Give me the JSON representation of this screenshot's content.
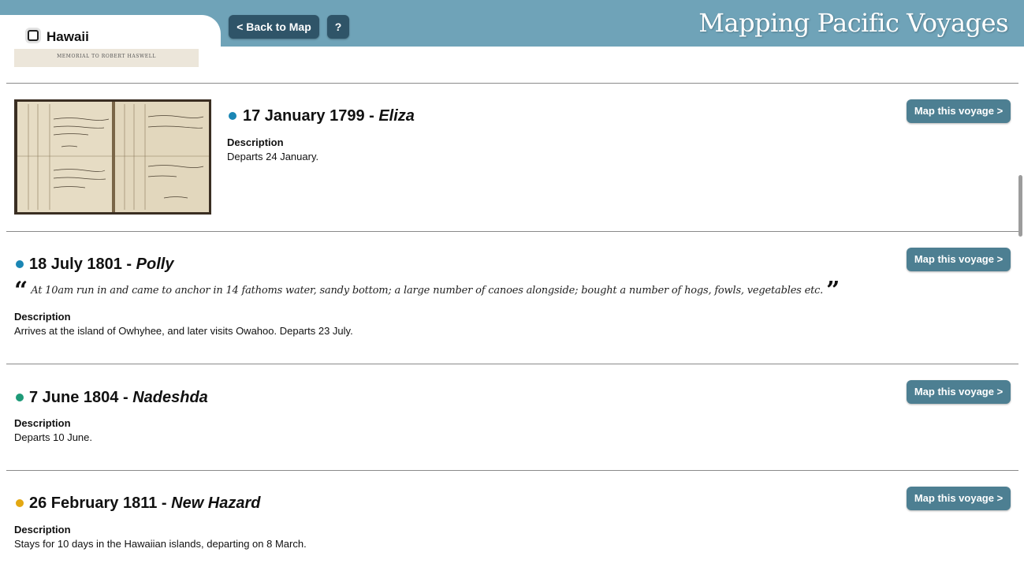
{
  "header": {
    "site_title": "Mapping Pacific Voyages",
    "back_label": "< Back to Map",
    "help_label": "?",
    "header_color": "#6fa3b8"
  },
  "place": {
    "name": "Hawaii",
    "memorial_caption": "MEMORIAL TO ROBERT HASWELL"
  },
  "labels": {
    "description": "Description",
    "map_button": "Map this voyage >"
  },
  "entries": [
    {
      "date": "17 January 1799",
      "separator": " - ",
      "ship": "Eliza",
      "dot_color": "#1a86b4",
      "description": "Departs 24 January.",
      "image": "logbook-image"
    },
    {
      "date": "18 July 1801",
      "separator": " - ",
      "ship": "Polly",
      "dot_color": "#1a86b4",
      "quote": "At 10am run in and came to anchor in 14 fathoms water, sandy bottom; a large number of canoes alongside; bought a number of hogs, fowls, vegetables etc.",
      "description": "Arrives at the island of Owhyhee, and later visits Owahoo. Departs 23 July."
    },
    {
      "date": "7 June 1804",
      "separator": " - ",
      "ship": "Nadeshda",
      "dot_color": "#1e9a78",
      "description": "Departs 10 June."
    },
    {
      "date": "26 February 1811",
      "separator": " - ",
      "ship": "New Hazard",
      "dot_color": "#e3a812",
      "description": "Stays for 10 days in the Hawaiian islands, departing on 8 March."
    }
  ]
}
